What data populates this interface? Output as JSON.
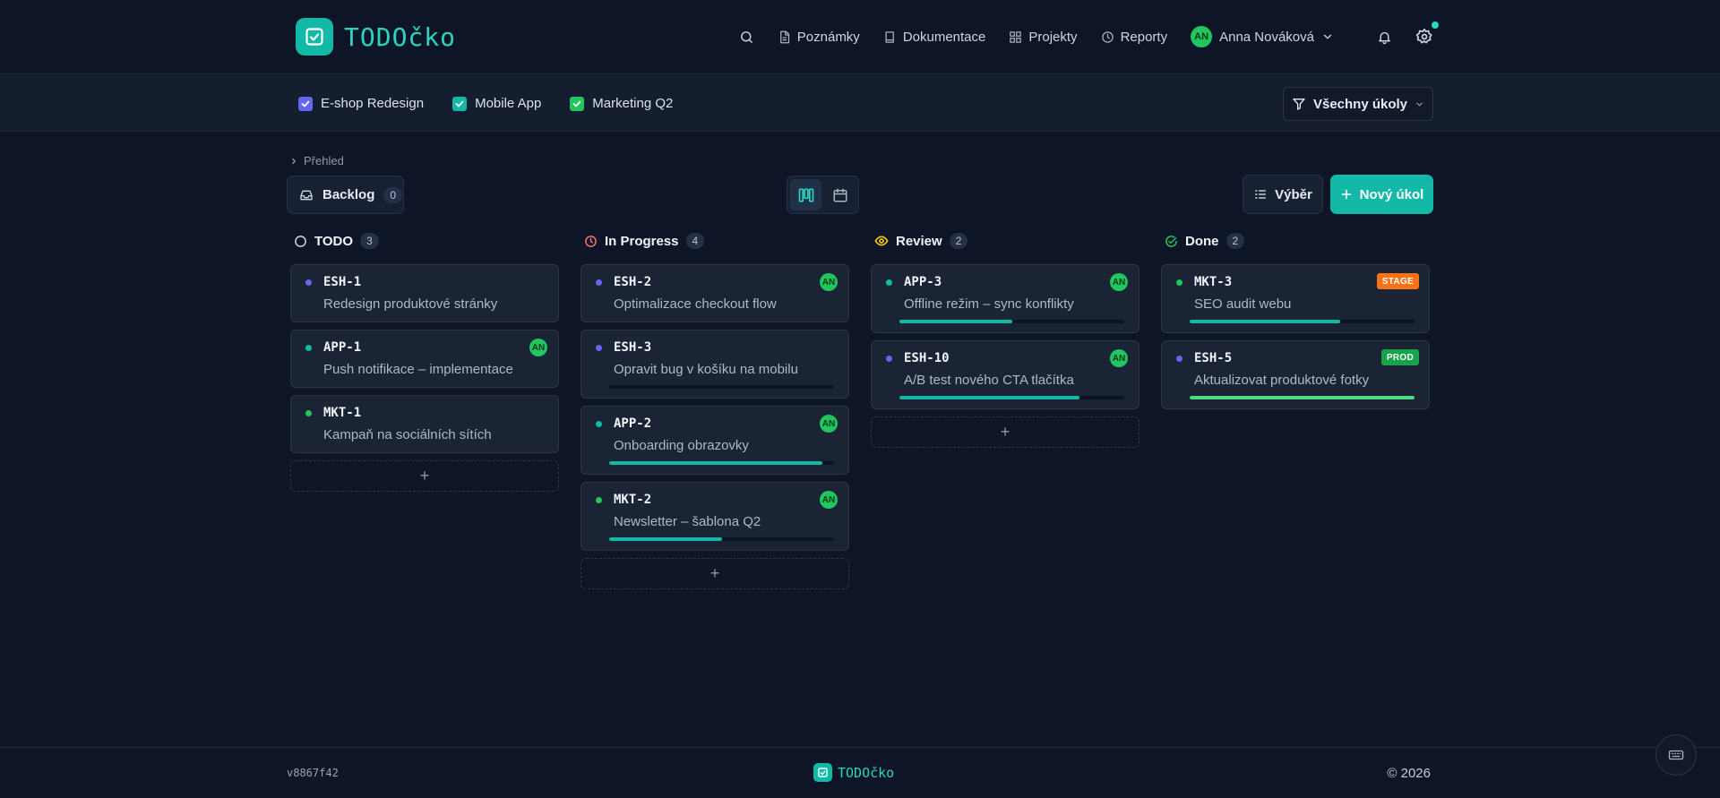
{
  "app": {
    "name": "TODOčko",
    "version": "v8867f42",
    "copyright": "© 2026"
  },
  "nav": {
    "links": [
      {
        "label": "Poznámky",
        "icon": "note-icon"
      },
      {
        "label": "Dokumentace",
        "icon": "book-icon"
      },
      {
        "label": "Projekty",
        "icon": "grid-icon"
      },
      {
        "label": "Reporty",
        "icon": "clock-icon"
      }
    ],
    "user": {
      "initials": "AN",
      "name": "Anna Nováková"
    }
  },
  "projects": [
    {
      "label": "E-shop Redesign",
      "color": "#6366f1"
    },
    {
      "label": "Mobile App",
      "color": "#14b8a6"
    },
    {
      "label": "Marketing Q2",
      "color": "#22c55e"
    }
  ],
  "filter": {
    "label": "Všechny úkoly"
  },
  "breadcrumb": "Přehled",
  "backlog": {
    "label": "Backlog",
    "count": "0"
  },
  "toolbar": {
    "select_label": "Výběr",
    "new_label": "Nový úkol"
  },
  "colors": {
    "accent": "#14b8a6",
    "todo": "#d1d5db",
    "in_progress": "#f87171",
    "review": "#facc15",
    "done": "#22c55e",
    "stage": "#f97316",
    "prod": "#16a34a"
  },
  "columns": [
    {
      "title": "TODO",
      "count": "3",
      "icon": "circle-icon",
      "cards": [
        {
          "key": "ESH-1",
          "title": "Redesign produktové stránky",
          "dot": "#6366f1"
        },
        {
          "key": "APP-1",
          "title": "Push notifikace – implementace",
          "dot": "#14b8a6",
          "assignee": "AN"
        },
        {
          "key": "MKT-1",
          "title": "Kampaň na sociálních sítích",
          "dot": "#22c55e"
        }
      ]
    },
    {
      "title": "In Progress",
      "count": "4",
      "icon": "clock-icon",
      "cards": [
        {
          "key": "ESH-2",
          "title": "Optimalizace checkout flow",
          "dot": "#6366f1",
          "assignee": "AN"
        },
        {
          "key": "ESH-3",
          "title": "Opravit bug v košíku na mobilu",
          "dot": "#6366f1",
          "progress": 0
        },
        {
          "key": "APP-2",
          "title": "Onboarding obrazovky",
          "dot": "#14b8a6",
          "assignee": "AN",
          "progress": 95
        },
        {
          "key": "MKT-2",
          "title": "Newsletter – šablona Q2",
          "dot": "#22c55e",
          "assignee": "AN",
          "progress": 50
        }
      ]
    },
    {
      "title": "Review",
      "count": "2",
      "icon": "eye-icon",
      "cards": [
        {
          "key": "APP-3",
          "title": "Offline režim – sync konflikty",
          "dot": "#14b8a6",
          "assignee": "AN",
          "progress": 50
        },
        {
          "key": "ESH-10",
          "title": "A/B test nového CTA tlačítka",
          "dot": "#6366f1",
          "assignee": "AN",
          "progress": 80
        }
      ]
    },
    {
      "title": "Done",
      "count": "2",
      "icon": "check-circle-icon",
      "cards": [
        {
          "key": "MKT-3",
          "title": "SEO audit webu",
          "dot": "#22c55e",
          "tag": "STAGE",
          "progress": 67
        },
        {
          "key": "ESH-5",
          "title": "Aktualizovat produktové fotky",
          "dot": "#6366f1",
          "tag": "PROD",
          "progress": 100,
          "progress_color": "#4ade80"
        }
      ]
    }
  ]
}
